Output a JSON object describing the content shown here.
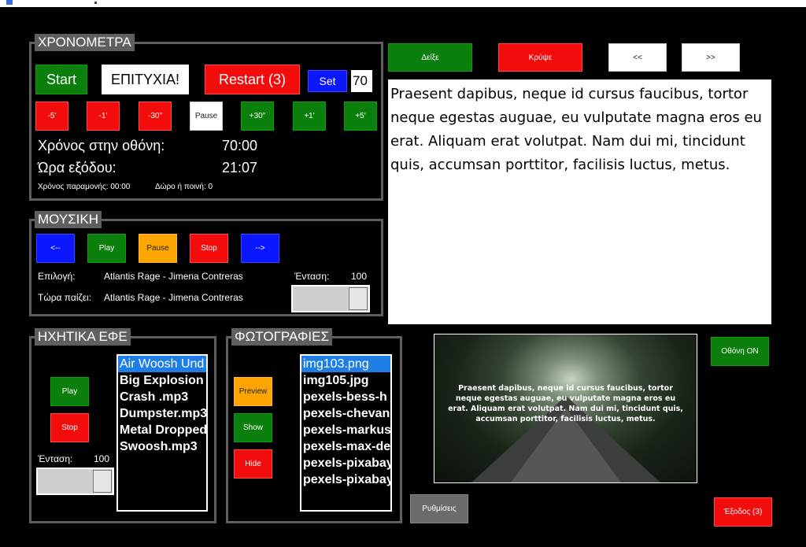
{
  "timers": {
    "title": "ΧΡΟΝΟΜΕΤΡΑ",
    "start_label": "Start",
    "status_text": "ΕΠΙΤΥΧΙΑ!",
    "restart_label": "Restart (3)",
    "set_label": "Set",
    "set_value": "70",
    "adjust_buttons": [
      "-5'",
      "-1'",
      "-30\"",
      "Pause",
      "+30\"",
      "+1'",
      "+5'"
    ],
    "screen_time_label": "Χρόνος στην οθόνη:",
    "screen_time_value": "70:00",
    "exit_time_label": "Ώρα εξόδου:",
    "exit_time_value": "21:07",
    "stay_time_text": "Χρόνος παραμονής: 00:00",
    "bonus_text": "Δώρο ή ποινή:  0"
  },
  "music": {
    "title": "ΜΟΥΣΙΚΗ",
    "prev_label": "<--",
    "play_label": "Play",
    "pause_label": "Pause",
    "stop_label": "Stop",
    "next_label": "-->",
    "selection_label": "Επιλογή:",
    "selection_value": "Atlantis Rage - Jimena Contreras",
    "now_playing_label": "Τώρα παίζει:",
    "now_playing_value": "Atlantis Rage - Jimena Contreras",
    "volume_label": "Ένταση:",
    "volume_value": "100",
    "volume_level": 1.0
  },
  "sfx": {
    "title": "ΗΧΗΤΙΚΑ ΕΦΕ",
    "play_label": "Play",
    "stop_label": "Stop",
    "volume_label": "Ένταση:",
    "volume_value": "100",
    "volume_level": 1.0,
    "files": [
      "Air Woosh Und",
      "Big Explosion",
      "Crash .mp3",
      "Dumpster.mp3",
      "Metal Dropped",
      "Swoosh.mp3"
    ],
    "selected_index": 0
  },
  "photos": {
    "title": "ΦΩΤΟΓΡΑΦΙΕΣ",
    "preview_label": "Preview",
    "show_label": "Show",
    "hide_label": "Hide",
    "files": [
      "img103.png",
      "img105.jpg",
      "pexels-bess-h",
      "pexels-chevan",
      "pexels-markus",
      "pexels-max-de",
      "pexels-pixabay",
      "pexels-pixabay"
    ],
    "selected_index": 0
  },
  "text_panel": {
    "show_label": "Δείξε",
    "hide_label": "Κρύψε",
    "prev_label": "<<",
    "next_label": ">>",
    "body": "Praesent dapibus, neque id cursus faucibus, tortor neque egestas auguae, eu vulputate magna eros eu erat. Aliquam erat volutpat. Nam dui mi, tincidunt quis, accumsan porttitor, facilisis luctus, metus.",
    "preview_text": "Praesent dapibus, neque id cursus faucibus, tortor neque egestas auguae, eu vulputate magna eros eu erat. Aliquam erat volutpat. Nam dui mi, tincidunt quis, accumsan porttitor, facilisis luctus, metus."
  },
  "screen_on_label": "Οθόνη ON",
  "settings_label": "Ρυθμίσεις",
  "exit_label": "Έξοδος (3)",
  "colors": {
    "green": "#0b7f0b",
    "red": "#f20c0c",
    "blue": "#0b17ff",
    "orange": "#ffa500",
    "frame": "#5f5f5f",
    "selection": "#1e7ee6"
  },
  "icons": [
    "app-icon"
  ]
}
